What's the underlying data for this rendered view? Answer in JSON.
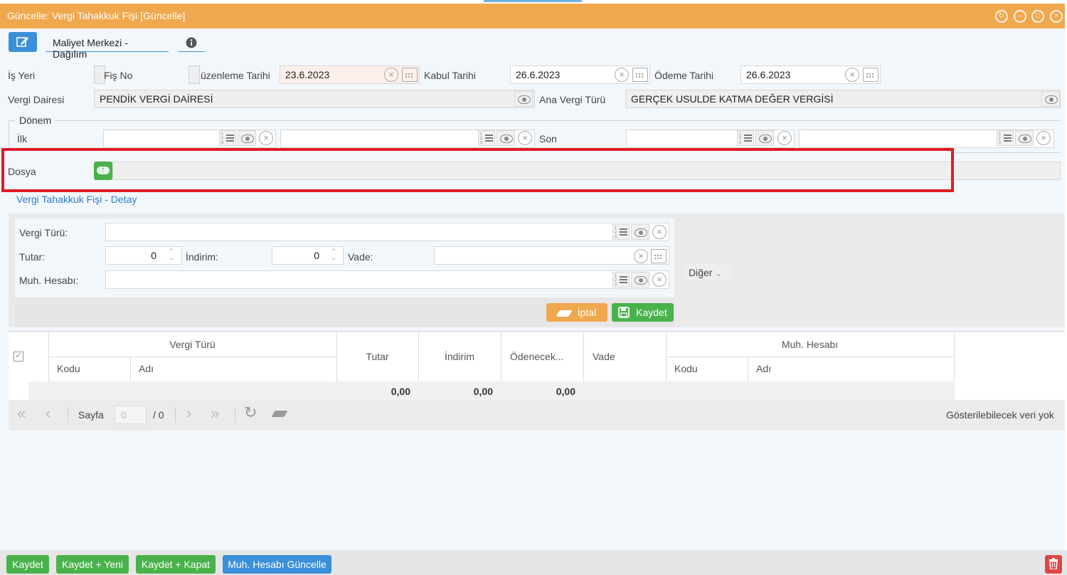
{
  "window": {
    "title": "Güncelle: Vergi Tahakkuk Fişi [Güncelle]"
  },
  "toolbar": {
    "tab_label": "Maliyet Merkezi - Dağılım"
  },
  "form": {
    "is_yeri_label": "İş Yeri",
    "fis_no_label": "Fiş No",
    "duzenleme_label": "üzenleme Tarihi",
    "duzenleme_value": "23.6.2023",
    "kabul_label": "Kabul Tarihi",
    "kabul_value": "26.6.2023",
    "odeme_label": "Ödeme Tarihi",
    "odeme_value": "26.6.2023",
    "vergi_dairesi_label": "Vergi Dairesi",
    "vergi_dairesi_value": "PENDİK VERGİ DAİRESİ",
    "ana_vergi_label": "Ana Vergi Türü",
    "ana_vergi_value": "GERÇEK USULDE KATMA DEĞER VERGİSİ",
    "donem_legend": "Dönem",
    "ilk_label": "İlk",
    "son_label": "Son",
    "dosya_label": "Dosya"
  },
  "detail": {
    "title": "Vergi Tahakkuk Fişi - Detay",
    "vergi_turu_label": "Vergi Türü:",
    "tutar_label": "Tutar:",
    "tutar_value": "0",
    "indirim_label": "İndirim:",
    "indirim_value": "0",
    "vade_label": "Vade:",
    "muh_hesabi_label": "Muh. Hesabı:",
    "diger_label": "Diğer",
    "iptal_label": "İptal",
    "kaydet_label": "Kaydet"
  },
  "grid": {
    "headers": {
      "vergi_turu": "Vergi Türü",
      "kodu": "Kodu",
      "adi": "Adı",
      "tutar": "Tutar",
      "indirim": "İndirim",
      "odenecek": "Ödenecek...",
      "vade": "Vade",
      "muh_hesabi": "Muh. Hesabı",
      "kodu2": "Kodu",
      "adi2": "Adı"
    },
    "totals": {
      "tutar": "0,00",
      "indirim": "0,00",
      "odenecek": "0,00"
    },
    "pager": {
      "sayfa_label": "Sayfa",
      "page_value": "0",
      "total_pages": "/ 0",
      "status": "Gösterilebilecek veri yok"
    }
  },
  "footer": {
    "kaydet": "Kaydet",
    "kaydet_yeni": "Kaydet + Yeni",
    "kaydet_kapat": "Kaydet + Kapat",
    "muh_guncelle": "Muh. Hesabı Güncelle"
  },
  "colors": {
    "accent_orange": "#f0a84e",
    "accent_blue": "#3a8fd9",
    "accent_green": "#49b24b",
    "highlight_red": "#e01b24"
  }
}
